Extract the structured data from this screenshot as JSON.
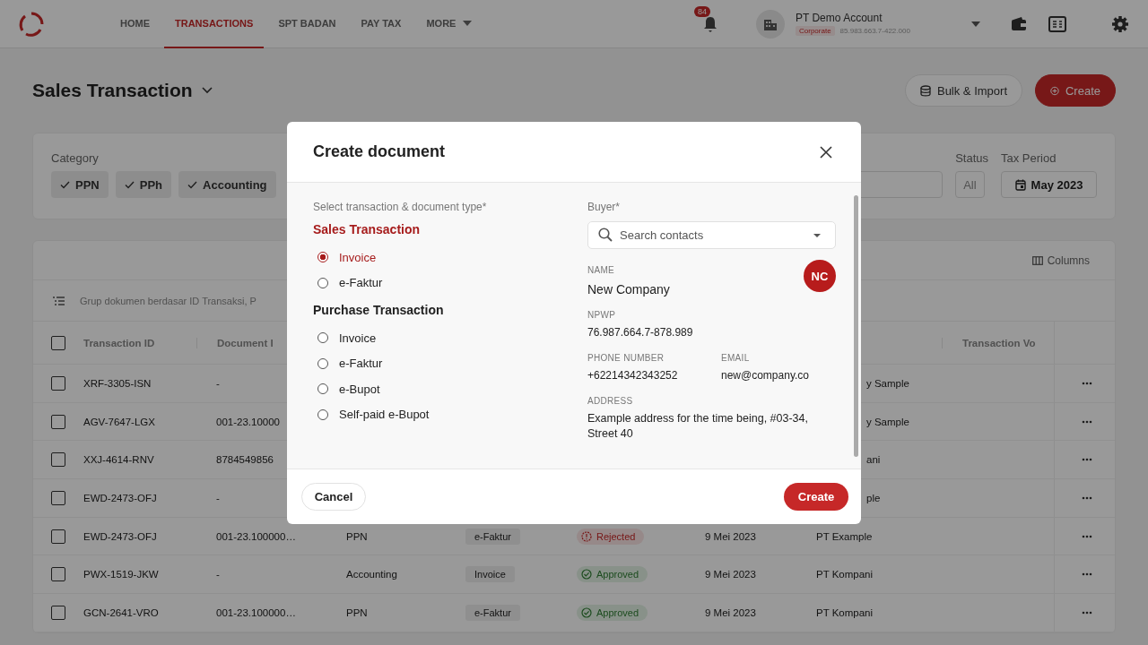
{
  "nav": {
    "tabs": [
      {
        "label": "HOME",
        "selected": false,
        "kind": "link"
      },
      {
        "label": "TRANSACTIONS",
        "selected": true,
        "kind": "link"
      },
      {
        "label": "SPT BADAN",
        "selected": false,
        "kind": "link"
      },
      {
        "label": "PAY TAX",
        "selected": false,
        "kind": "link"
      },
      {
        "label": "MORE",
        "selected": false,
        "kind": "menu"
      }
    ],
    "notifications": "84",
    "account": {
      "name": "PT Demo Account",
      "type": "Corporate",
      "npwp": "85.983.663.7-422.000"
    }
  },
  "page": {
    "title": "Sales Transaction",
    "buttons": [
      {
        "label": "Bulk & Import",
        "kind": "secondary"
      },
      {
        "label": "Create",
        "kind": "primary"
      }
    ]
  },
  "filters": {
    "category_label": "Category",
    "chips": [
      {
        "label": "PPN",
        "checked": true
      },
      {
        "label": "PPh",
        "checked": true
      },
      {
        "label": "Accounting",
        "checked": true
      }
    ],
    "status": {
      "label": "Status",
      "value": "All"
    },
    "tax_period": {
      "label": "Tax Period",
      "value": "May 2023"
    }
  },
  "table": {
    "columns_button": "Columns",
    "group_hint": "Grup dokumen berdasar ID Transaksi, P",
    "all_checked": false,
    "columns": [
      {
        "label": "Transaction ID"
      },
      {
        "label": "Document I"
      },
      {
        "label": "Transaction Vo"
      }
    ],
    "rows": [
      {
        "checked": false,
        "id": "XRF-3305-ISN",
        "document_id": "-",
        "customer": "y Sample"
      },
      {
        "checked": false,
        "id": "AGV-7647-LGX",
        "document_id": "001-23.10000",
        "customer": "y Sample"
      },
      {
        "checked": false,
        "id": "XXJ-4614-RNV",
        "document_id": "8784549856",
        "customer": "ani"
      },
      {
        "checked": false,
        "id": "EWD-2473-OFJ",
        "document_id": "-",
        "customer": "ple"
      },
      {
        "checked": false,
        "id": "EWD-2473-OFJ",
        "document_id": "001-23.100000…",
        "category": "PPN",
        "type": "e-Faktur",
        "status": {
          "label": "Rejected",
          "kind": "rejected"
        },
        "date": "9 Mei 2023",
        "customer": "PT Example"
      },
      {
        "checked": false,
        "id": "PWX-1519-JKW",
        "document_id": "-",
        "category": "Accounting",
        "type": "Invoice",
        "status": {
          "label": "Approved",
          "kind": "approved"
        },
        "date": "9 Mei 2023",
        "customer": "PT Kompani"
      },
      {
        "checked": false,
        "id": "GCN-2641-VRO",
        "document_id": "001-23.100000…",
        "category": "PPN",
        "type": "e-Faktur",
        "status": {
          "label": "Approved",
          "kind": "approved"
        },
        "date": "9 Mei 2023",
        "customer": "PT Kompani"
      }
    ]
  },
  "modal": {
    "title": "Create document",
    "type_label": "Select transaction & document type*",
    "groups": [
      {
        "title": "Sales Transaction",
        "options": [
          {
            "label": "Invoice",
            "selected": true
          },
          {
            "label": "e-Faktur",
            "selected": false
          }
        ]
      },
      {
        "title": "Purchase Transaction",
        "options": [
          {
            "label": "Invoice",
            "selected": false
          },
          {
            "label": "e-Faktur",
            "selected": false
          },
          {
            "label": "e-Bupot",
            "selected": false
          },
          {
            "label": "Self-paid e-Bupot",
            "selected": false
          }
        ]
      }
    ],
    "buyer": {
      "label": "Buyer*",
      "placeholder": "Search contacts",
      "initials": "NC",
      "fields": [
        {
          "kind": "name",
          "label": "NAME",
          "value": "New Company"
        },
        {
          "kind": "full",
          "label": "NPWP",
          "value": "76.987.664.7-878.989"
        },
        {
          "kind": "half",
          "label": "PHONE NUMBER",
          "value": "+62214342343252"
        },
        {
          "kind": "half",
          "label": "EMAIL",
          "value": "new@company.co"
        },
        {
          "kind": "full",
          "label": "ADDRESS",
          "value": "Example address for the time being, #03-34, Street 40"
        }
      ]
    },
    "cancel": "Cancel",
    "submit": "Create"
  }
}
